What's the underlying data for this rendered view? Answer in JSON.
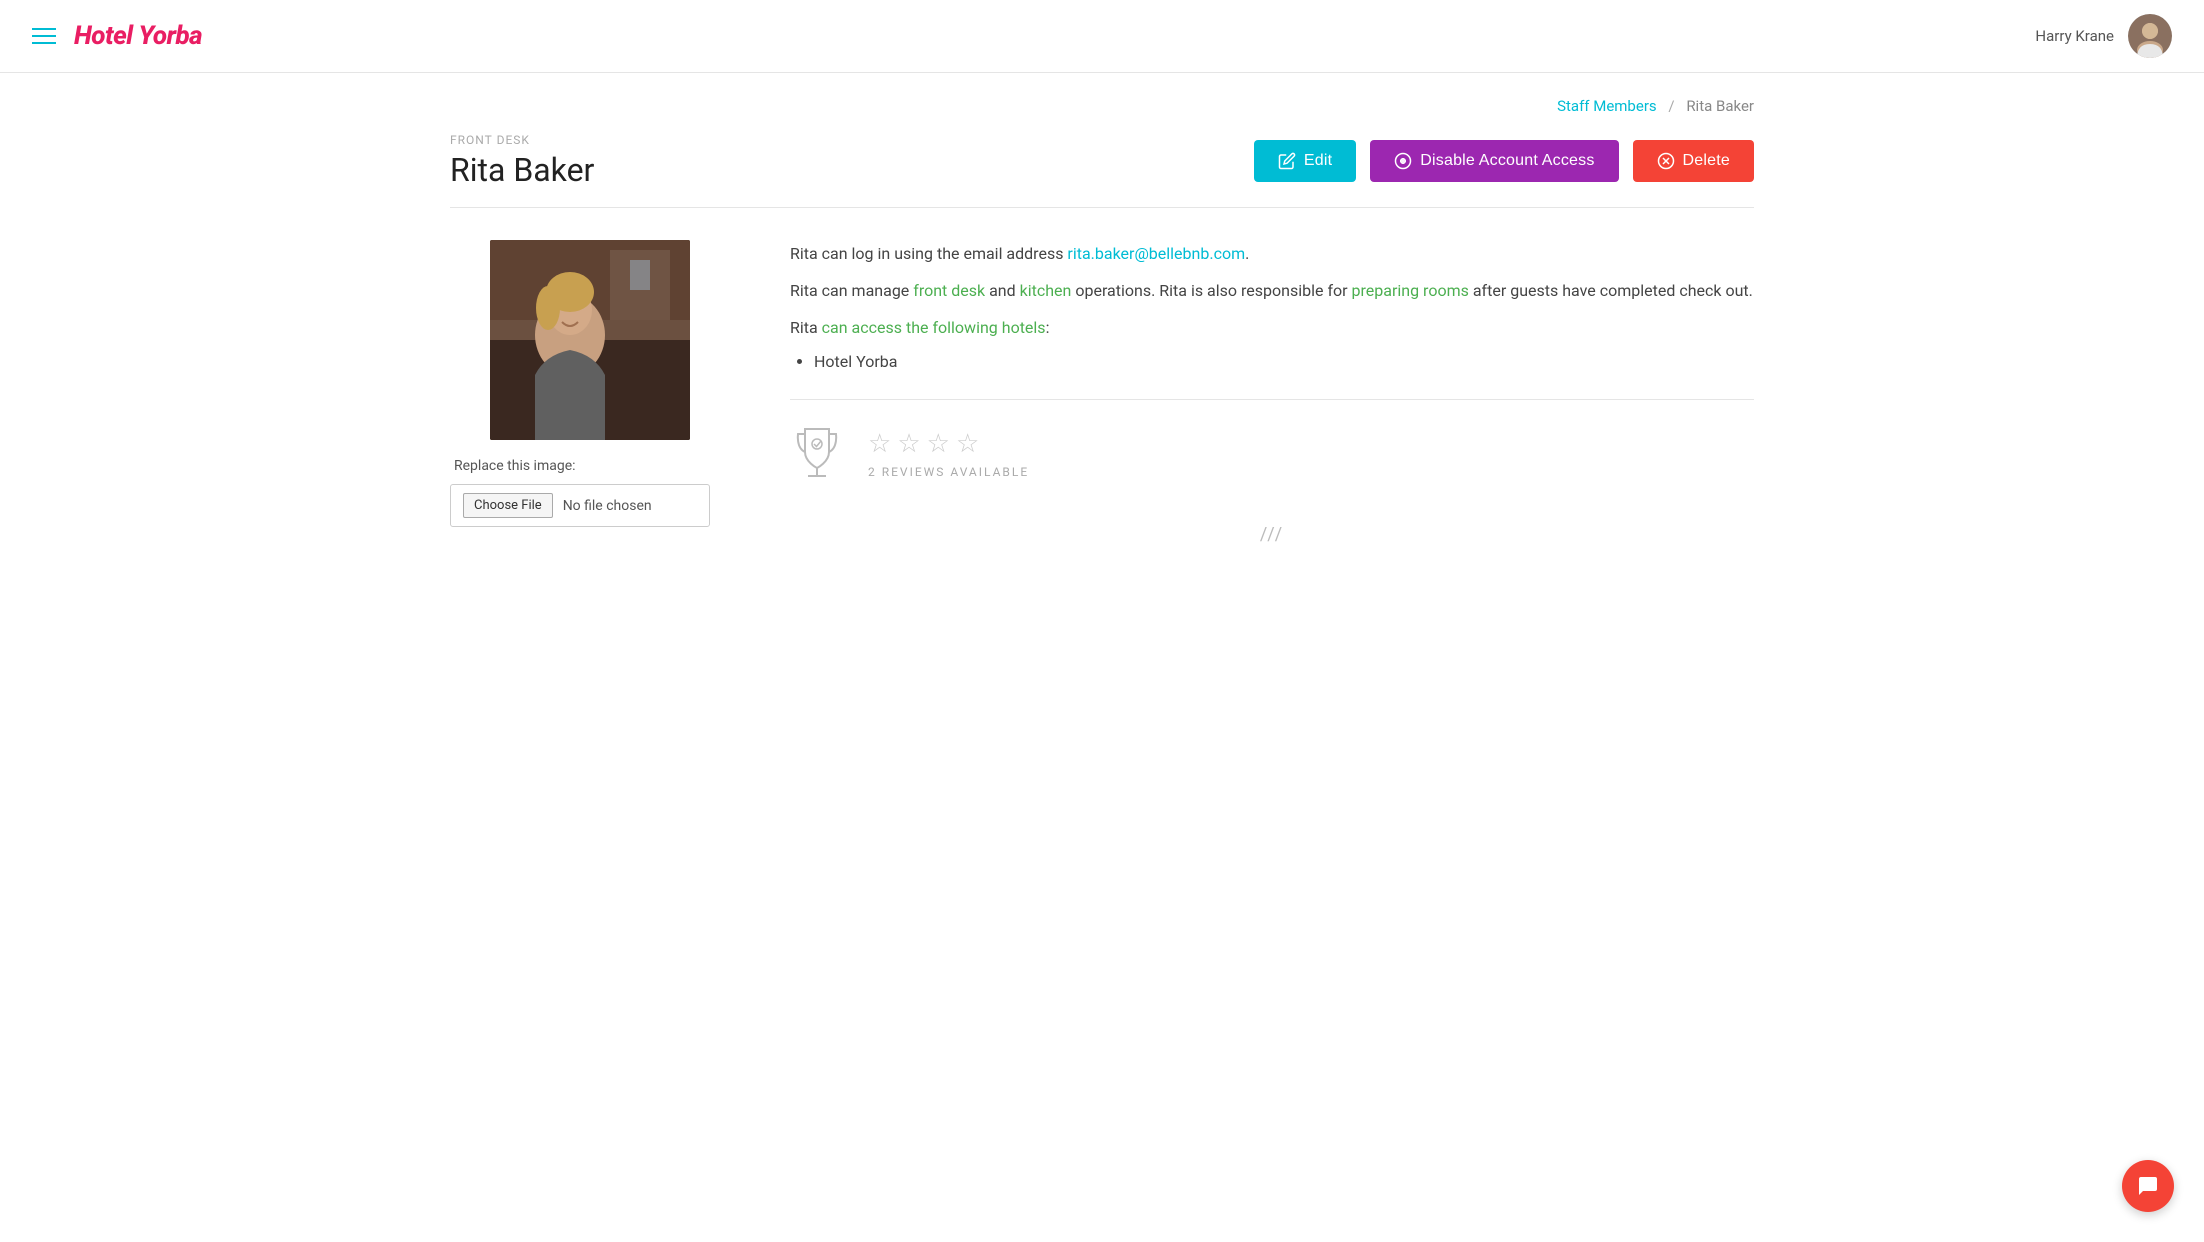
{
  "header": {
    "logo": "Hotel Yorba",
    "user_name": "Harry Krane"
  },
  "breadcrumb": {
    "parent_label": "Staff Members",
    "current_label": "Rita Baker",
    "separator": "/"
  },
  "page_header": {
    "role": "FRONT DESK",
    "name": "Rita Baker",
    "edit_btn": "Edit",
    "disable_btn": "Disable Account Access",
    "delete_btn": "Delete"
  },
  "left_panel": {
    "replace_label": "Replace this image:",
    "choose_file_btn": "Choose File",
    "no_file_text": "No file chosen"
  },
  "right_panel": {
    "email_prefix": "Rita can log in using the email address ",
    "email": "rita.baker@bellebnb.com",
    "manage_prefix": "Rita can manage ",
    "manage_role1": "front desk",
    "manage_mid": " and ",
    "manage_role2": "kitchen",
    "manage_suffix": " operations. Rita is also responsible for ",
    "manage_role3": "preparing rooms",
    "manage_end": " after guests have completed check out.",
    "access_prefix": "Rita ",
    "access_link": "can access the following hotels",
    "access_suffix": ":",
    "hotels": [
      "Hotel Yorba"
    ]
  },
  "reviews": {
    "count_label": "2 REVIEWS AVAILABLE",
    "stars_count": 4
  },
  "bottom_deco": "///",
  "colors": {
    "cyan": "#00bcd4",
    "pink": "#e91e63",
    "purple": "#9c27b0",
    "red": "#f44336",
    "green": "#4caf50"
  }
}
